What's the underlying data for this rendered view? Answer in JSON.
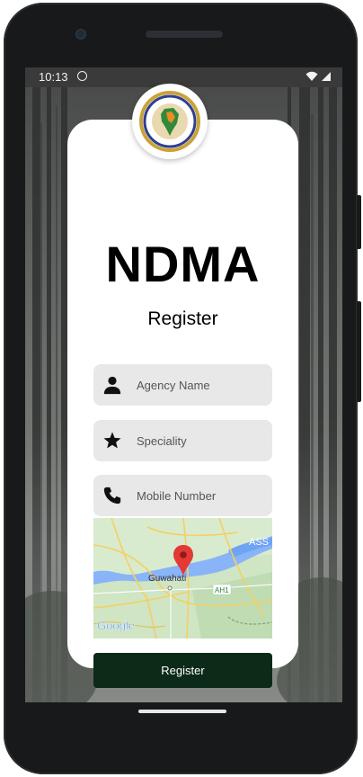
{
  "status_bar": {
    "time": "10:13"
  },
  "app": {
    "brand": "NDMA",
    "subtitle": "Register",
    "fields": {
      "agency_placeholder": "Agency Name",
      "speciality_placeholder": "Speciality",
      "mobile_placeholder": "Mobile Number"
    },
    "map": {
      "city_label": "Guwahati",
      "region_label": "ASS",
      "road_label": "AH1",
      "attribution": "Google"
    },
    "register_button": "Register"
  },
  "colors": {
    "button_bg": "#0b2a18",
    "field_bg": "#e8e8e8",
    "map_pin": "#e53935"
  }
}
